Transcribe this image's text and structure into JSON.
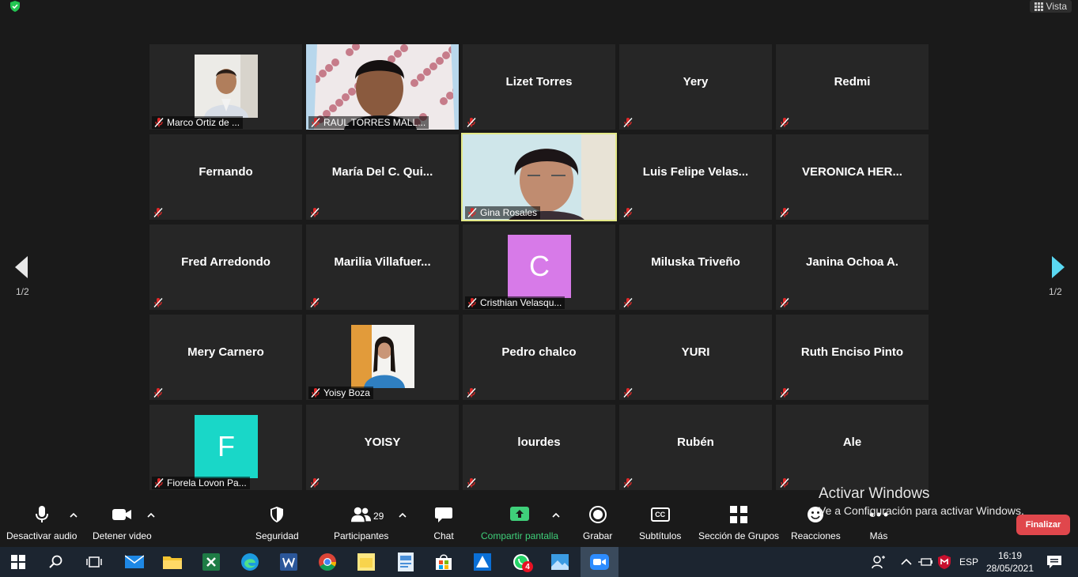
{
  "topbar": {
    "view_label": "Vista"
  },
  "pages": {
    "left": "1/2",
    "right": "1/2"
  },
  "participants": [
    {
      "name": "Marco Ortiz de ...",
      "kind": "photo"
    },
    {
      "name": "RAUL TORRES MALL...",
      "kind": "video"
    },
    {
      "name": "Lizet Torres",
      "kind": "name"
    },
    {
      "name": "Yery",
      "kind": "name"
    },
    {
      "name": "Redmi",
      "kind": "name"
    },
    {
      "name": "Fernando",
      "kind": "name"
    },
    {
      "name": "María Del C. Qui...",
      "kind": "name"
    },
    {
      "name": "Gina Rosales",
      "kind": "video-active"
    },
    {
      "name": "Luis Felipe Velas...",
      "kind": "name"
    },
    {
      "name": "VERONICA HER...",
      "kind": "name"
    },
    {
      "name": "Fred Arredondo",
      "kind": "name"
    },
    {
      "name": "Marilia Villafuer...",
      "kind": "name"
    },
    {
      "name": "Cristhian Velasqu...",
      "kind": "letter",
      "letter": "C",
      "color": "#d77ae8"
    },
    {
      "name": "Miluska Triveño",
      "kind": "name"
    },
    {
      "name": "Janina Ochoa A.",
      "kind": "name"
    },
    {
      "name": "Mery Carnero",
      "kind": "name"
    },
    {
      "name": "Yoisy Boza",
      "kind": "photo"
    },
    {
      "name": "Pedro chalco",
      "kind": "name"
    },
    {
      "name": "YURI",
      "kind": "name"
    },
    {
      "name": "Ruth Enciso Pinto",
      "kind": "name"
    },
    {
      "name": "Fiorela Lovon Pa...",
      "kind": "letter",
      "letter": "F",
      "color": "#19d7c8"
    },
    {
      "name": "YOISY",
      "kind": "name"
    },
    {
      "name": "lourdes",
      "kind": "name"
    },
    {
      "name": "Rubén",
      "kind": "name"
    },
    {
      "name": "Ale",
      "kind": "name"
    }
  ],
  "toolbar": {
    "audio": "Desactivar audio",
    "video": "Detener video",
    "security": "Seguridad",
    "participants": "Participantes",
    "participants_count": "29",
    "chat": "Chat",
    "share": "Compartir pantalla",
    "record": "Grabar",
    "subtitles": "Subtítulos",
    "subtitles_icon_text": "CC",
    "breakout": "Sección de Grupos",
    "reactions": "Reacciones",
    "more": "Más",
    "end": "Finalizar"
  },
  "colors": {
    "share_green": "#3fd07a",
    "end_red": "#e0474c",
    "active_border": "#e3e887"
  },
  "activation": {
    "title": "Activar Windows",
    "subtitle": "Ve a Configuración para activar Windows."
  },
  "taskbar": {
    "whatsapp_badge": "4",
    "lang": "ESP",
    "time": "16:19",
    "date": "28/05/2021"
  }
}
